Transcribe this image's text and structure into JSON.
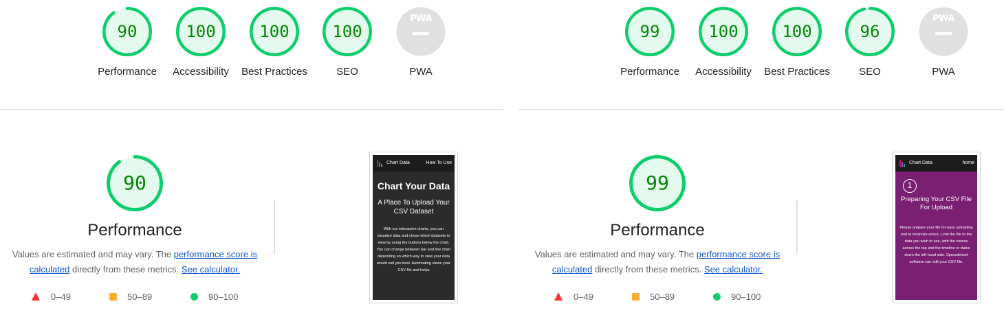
{
  "reports": [
    {
      "gauges": [
        {
          "score": "90",
          "label": "Performance",
          "value": 90
        },
        {
          "score": "100",
          "label": "Accessibility",
          "value": 100
        },
        {
          "score": "100",
          "label": "Best Practices",
          "value": 100
        },
        {
          "score": "100",
          "label": "SEO",
          "value": 100
        },
        {
          "badge": "PWA",
          "label": "PWA"
        }
      ],
      "performance": {
        "score": "90",
        "value": 90,
        "title": "Performance",
        "desc_prefix": "Values are estimated and may vary. The ",
        "link_score": "performance score is calculated",
        "desc_middle": " directly from these metrics. ",
        "link_calc": "See calculator."
      },
      "legend": [
        {
          "range": "0–49",
          "shape": "triangle",
          "color": "#ff3333"
        },
        {
          "range": "50–89",
          "shape": "square",
          "color": "#ffaa33"
        },
        {
          "range": "90–100",
          "shape": "circle",
          "color": "#0cce6b"
        }
      ],
      "screenshot": {
        "brand": "Chart Data",
        "nav_link": "How To Use",
        "heading": "Chart Your Data",
        "subheading": "A Place To Upload Your CSV Dataset",
        "body": "With our interactive charts, you can visualize data and chose which datasets to view by using the buttons below the chart. You can change between bar and line chart depending on which way to view your data would suit you best. Automating views your CSV file and helps",
        "background": "#2b2b2b"
      }
    },
    {
      "gauges": [
        {
          "score": "99",
          "label": "Performance",
          "value": 99
        },
        {
          "score": "100",
          "label": "Accessibility",
          "value": 100
        },
        {
          "score": "100",
          "label": "Best Practices",
          "value": 100
        },
        {
          "score": "96",
          "label": "SEO",
          "value": 96
        },
        {
          "badge": "PWA",
          "label": "PWA"
        }
      ],
      "performance": {
        "score": "99",
        "value": 99,
        "title": "Performance",
        "desc_prefix": "Values are estimated and may vary. The ",
        "link_score": "performance score is calculated",
        "desc_middle": " directly from these metrics. ",
        "link_calc": "See calculator."
      },
      "legend": [
        {
          "range": "0–49",
          "shape": "triangle",
          "color": "#ff3333"
        },
        {
          "range": "50–89",
          "shape": "square",
          "color": "#ffaa33"
        },
        {
          "range": "90–100",
          "shape": "circle",
          "color": "#0cce6b"
        }
      ],
      "screenshot": {
        "brand": "Chart Data",
        "nav_link": "home",
        "step_number": "1",
        "heading": "Preparing Your CSV File For Upload",
        "body": "Please prepare your file for easy uploading and to minimize errors. Limit the file to the data you wish to see, with the names across the top and the timeline or dates down the left hand side. Spreadsheet software can edit your CSV file.",
        "background": "#7a1f72"
      }
    }
  ],
  "colors": {
    "pass": "#0cce6b",
    "pass_fill": "#e5faef",
    "pass_text": "#008800",
    "pwa_gray": "#e0e0e0",
    "link": "#1155cc"
  }
}
